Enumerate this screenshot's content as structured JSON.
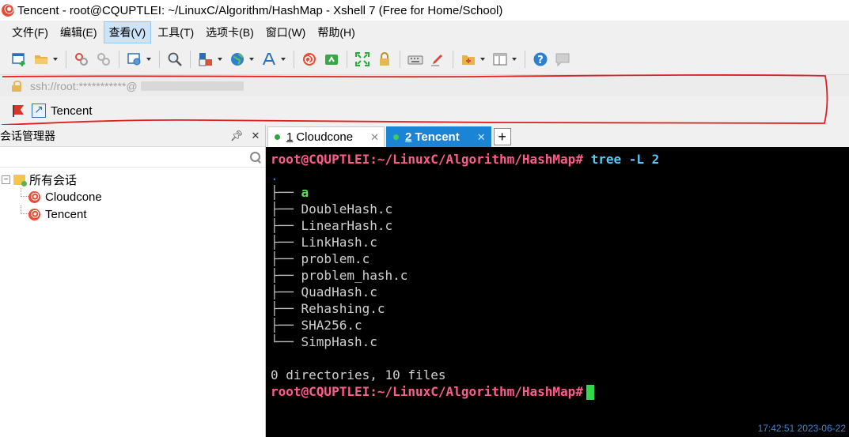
{
  "window": {
    "title": "Tencent - root@CQUPTLEI: ~/LinuxC/Algorithm/HashMap - Xshell 7 (Free for Home/School)"
  },
  "menu": {
    "items": [
      "文件(F)",
      "编辑(E)",
      "查看(V)",
      "工具(T)",
      "选项卡(B)",
      "窗口(W)",
      "帮助(H)"
    ],
    "active_index": 2
  },
  "address_bar": {
    "text": "ssh://root:***********@"
  },
  "links_bar": {
    "shortcut_label": "Tencent"
  },
  "session_manager": {
    "title": "会话管理器",
    "search_placeholder": "",
    "root_label": "所有会话",
    "sessions": [
      "Cloudcone",
      "Tencent"
    ]
  },
  "tabs": [
    {
      "num": "1",
      "label": "Cloudcone",
      "active": false
    },
    {
      "num": "2",
      "label": "Tencent",
      "active": true
    }
  ],
  "terminal": {
    "prompt": "root@CQUPTLEI:~/LinuxC/Algorithm/HashMap#",
    "command": "tree -L 2",
    "root_dot": ".",
    "entries": [
      "a",
      "DoubleHash.c",
      "LinearHash.c",
      "LinkHash.c",
      "problem.c",
      "problem_hash.c",
      "QuadHash.c",
      "Rehashing.c",
      "SHA256.c",
      "SimpHash.c"
    ],
    "summary": "0 directories, 10 files",
    "timestamp": "17:42:51 2023-06-22"
  },
  "colors": {
    "prompt": "#ff5c8d",
    "command": "#5ac8fa",
    "directory": "#53e05a",
    "cursor": "#32d74b",
    "active_tab": "#1b84d4",
    "annotation": "#e02020"
  }
}
